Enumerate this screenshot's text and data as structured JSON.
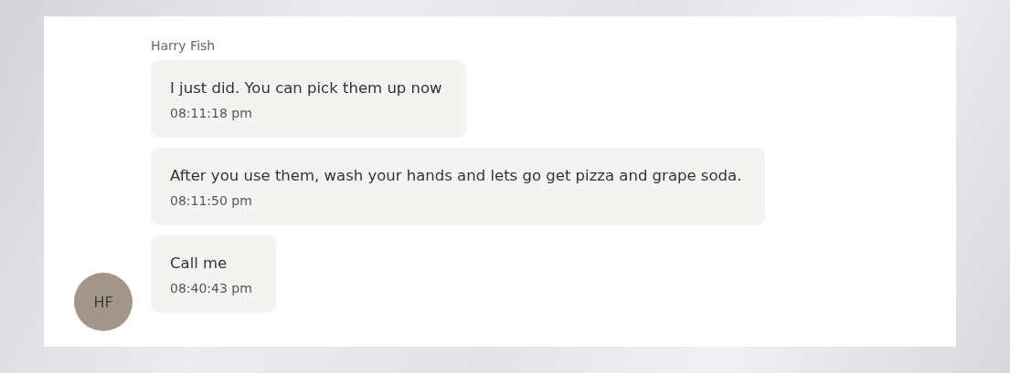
{
  "sender": "Harry Fish",
  "avatar": {
    "initials": "HF"
  },
  "messages": [
    {
      "text": "I just did. You can pick them up now",
      "time": "08:11:18 pm"
    },
    {
      "text": "After you use them, wash your hands and lets go get pizza and grape soda.",
      "time": "08:11:50 pm"
    },
    {
      "text": "Call me",
      "time": "08:40:43 pm"
    }
  ]
}
